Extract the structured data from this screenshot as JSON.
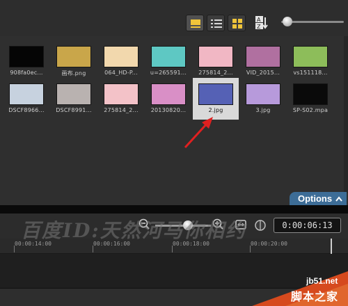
{
  "view_buttons": [
    {
      "icon": "thumbnail-strip-icon"
    },
    {
      "icon": "list-view-icon"
    },
    {
      "icon": "grid-view-icon"
    }
  ],
  "sort": {
    "icon": "sort-icon"
  },
  "thumb_size": {
    "level": 0.05
  },
  "media": {
    "tiles": [
      {
        "caption": "908fa0ec...",
        "selected": false,
        "color": "#050505"
      },
      {
        "caption": "画布.png",
        "selected": false,
        "color": "#c9a64a"
      },
      {
        "caption": "064_HD-P...",
        "selected": false,
        "color": "#f2d8ad"
      },
      {
        "caption": "u=265591...",
        "selected": false,
        "color": "#5ec8c3"
      },
      {
        "caption": "275814_2...",
        "selected": false,
        "color": "#f1b7c4"
      },
      {
        "caption": "VID_2015...",
        "selected": false,
        "color": "#b070a0"
      },
      {
        "caption": "vs151118...",
        "selected": false,
        "color": "#8dbd5a"
      },
      {
        "caption": "DSCF8966...",
        "selected": false,
        "color": "#c7d2df"
      },
      {
        "caption": "DSCF8991...",
        "selected": false,
        "color": "#b9b2b0"
      },
      {
        "caption": "275814_2...",
        "selected": false,
        "color": "#f3c2c8"
      },
      {
        "caption": "20130820...",
        "selected": false,
        "color": "#d98fc6"
      },
      {
        "caption": "2.jpg",
        "selected": true,
        "color": "#5561b5"
      },
      {
        "caption": "3.jpg",
        "selected": false,
        "color": "#b79adb"
      },
      {
        "caption": "SP-S02.mpa",
        "selected": false,
        "color": "#0a0a0a"
      }
    ]
  },
  "options": {
    "label": "Options"
  },
  "timeline": {
    "timecode": "0:00:06:13",
    "ruler_labels": [
      "00:00:14:00",
      "00:00:16:00",
      "00:00:18:00",
      "00:00:20:00"
    ]
  },
  "watermark": {
    "overlay_text": "百度ID:天然河马你相约",
    "site": "jb51.net",
    "name": "脚本之家"
  },
  "colors": {
    "accent": "#3d6d97",
    "selection": "#d9d9d9",
    "arrow": "#e02020",
    "active_view": "#f0c53a"
  }
}
